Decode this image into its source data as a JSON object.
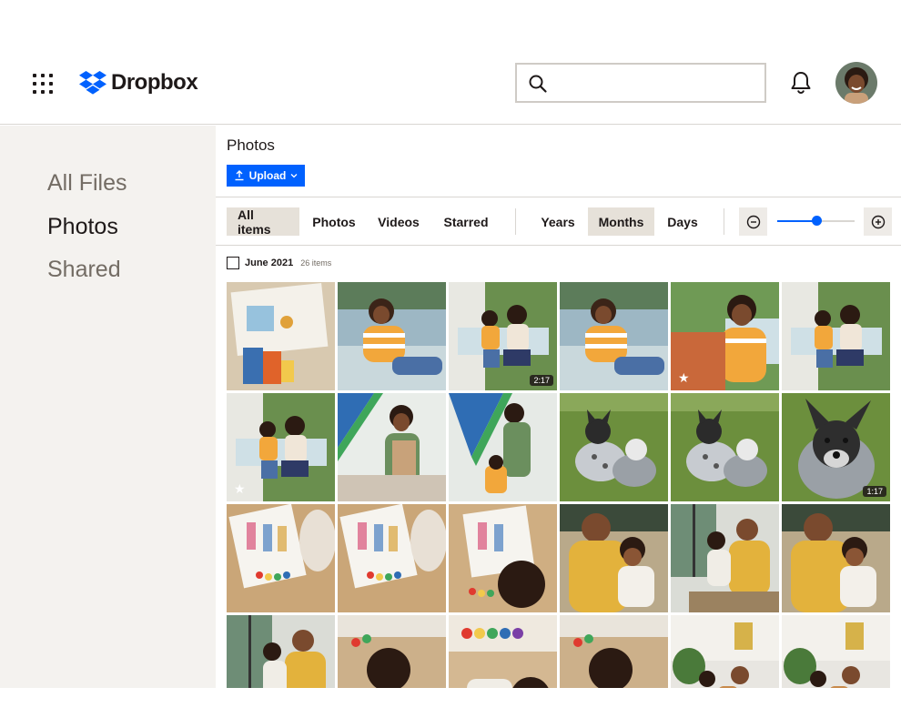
{
  "app": {
    "name": "Dropbox",
    "brand_color": "#0061fe"
  },
  "header": {
    "search": {
      "placeholder": "",
      "value": ""
    },
    "icons": [
      "apps-grid-icon",
      "search-icon",
      "bell-icon",
      "avatar"
    ]
  },
  "sidebar": {
    "items": [
      {
        "label": "All Files",
        "active": false
      },
      {
        "label": "Photos",
        "active": true
      },
      {
        "label": "Shared",
        "active": false
      }
    ]
  },
  "main": {
    "title": "Photos",
    "upload_label": "Upload",
    "filters": [
      {
        "label": "All items",
        "active": true
      },
      {
        "label": "Photos",
        "active": false
      },
      {
        "label": "Videos",
        "active": false
      },
      {
        "label": "Starred",
        "active": false
      }
    ],
    "time_scales": [
      {
        "label": "Years",
        "active": false
      },
      {
        "label": "Months",
        "active": true
      },
      {
        "label": "Days",
        "active": false
      }
    ],
    "zoom": {
      "level": 0.5
    },
    "group": {
      "label": "June 2021",
      "count": "26 items"
    },
    "tiles": [
      {
        "scene": "art-paper",
        "duration": "",
        "starred": false
      },
      {
        "scene": "person-striped",
        "duration": "",
        "starred": false
      },
      {
        "scene": "porch-swing",
        "duration": "2:17",
        "starred": false
      },
      {
        "scene": "person-striped",
        "duration": "",
        "starred": false
      },
      {
        "scene": "kid-closeup",
        "duration": "",
        "starred": true
      },
      {
        "scene": "porch-swing",
        "duration": "",
        "starred": false
      },
      {
        "scene": "porch-swing",
        "duration": "",
        "starred": true
      },
      {
        "scene": "painting-wall",
        "duration": "",
        "starred": false
      },
      {
        "scene": "painting-wall-2",
        "duration": "",
        "starred": false
      },
      {
        "scene": "dogs-grass",
        "duration": "",
        "starred": false
      },
      {
        "scene": "dogs-grass",
        "duration": "",
        "starred": false
      },
      {
        "scene": "dog-closeup",
        "duration": "1:17",
        "starred": false
      },
      {
        "scene": "drawing-floor",
        "duration": "",
        "starred": false
      },
      {
        "scene": "drawing-floor",
        "duration": "",
        "starred": false
      },
      {
        "scene": "drawing-floor-2",
        "duration": "",
        "starred": false
      },
      {
        "scene": "dad-yellow",
        "duration": "",
        "starred": false
      },
      {
        "scene": "dad-window",
        "duration": "",
        "starred": false
      },
      {
        "scene": "dad-yellow",
        "duration": "",
        "starred": false
      },
      {
        "scene": "dad-window",
        "duration": "",
        "starred": false
      },
      {
        "scene": "kid-floor",
        "duration": "",
        "starred": false
      },
      {
        "scene": "paint-floor",
        "duration": "",
        "starred": false
      },
      {
        "scene": "kid-floor",
        "duration": "",
        "starred": false
      },
      {
        "scene": "family-room",
        "duration": "",
        "starred": false
      },
      {
        "scene": "family-room",
        "duration": "",
        "starred": false
      }
    ]
  }
}
